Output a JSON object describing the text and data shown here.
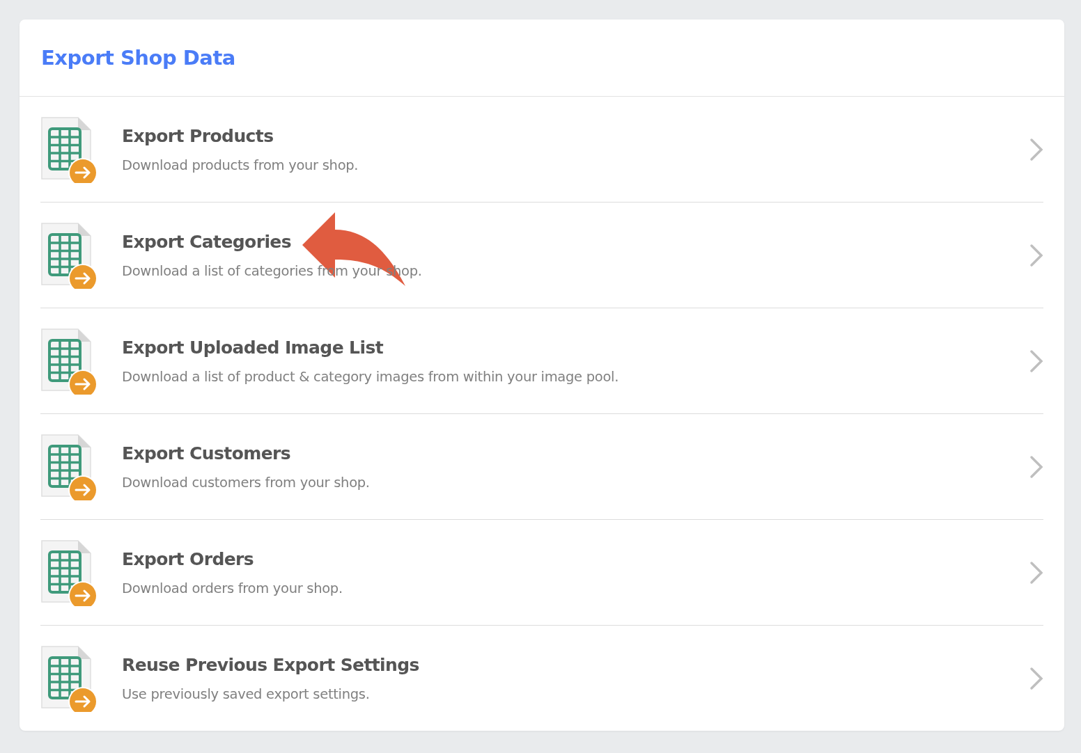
{
  "page": {
    "title": "Export Shop Data"
  },
  "items": [
    {
      "title": "Export Products",
      "description": "Download products from your shop."
    },
    {
      "title": "Export Categories",
      "description": "Download a list of categories from your shop."
    },
    {
      "title": "Export Uploaded Image List",
      "description": "Download a list of product & category images from within your image pool."
    },
    {
      "title": "Export Customers",
      "description": "Download customers from your shop."
    },
    {
      "title": "Export Orders",
      "description": "Download orders from your shop."
    },
    {
      "title": "Reuse Previous Export Settings",
      "description": "Use previously saved export settings."
    }
  ]
}
